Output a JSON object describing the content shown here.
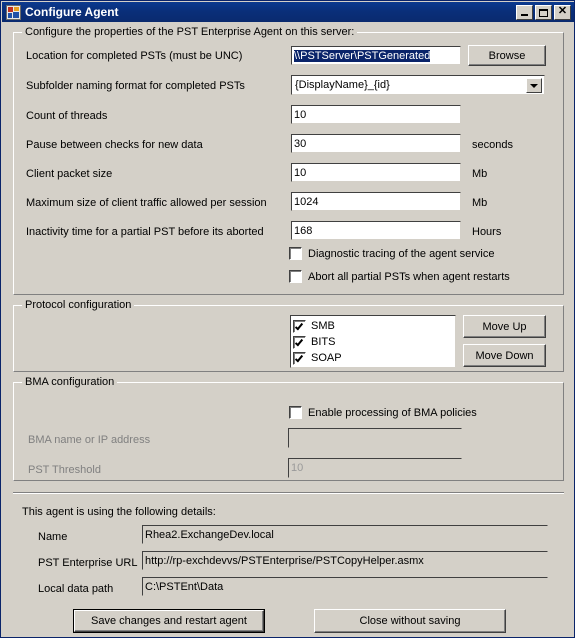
{
  "window": {
    "title": "Configure Agent",
    "icon": "application-form-icon",
    "controls": {
      "minimize": "minimize-button",
      "maximize": "maximize-button",
      "close": "close-button"
    }
  },
  "main_group": {
    "legend": "Configure the properties of the PST Enterprise Agent on this server:",
    "fields": [
      {
        "label": "Location for completed PSTs (must be UNC)",
        "value": "\\\\PSTServer\\PSTGenerated",
        "selected": true,
        "unit": ""
      },
      {
        "label": "Subfolder naming format for completed PSTs",
        "value": "{DisplayName}_{id}",
        "unit": "",
        "type": "combobox"
      },
      {
        "label": "Count of threads",
        "value": "10",
        "unit": ""
      },
      {
        "label": "Pause between checks for new data",
        "value": "30",
        "unit": "seconds"
      },
      {
        "label": "Client packet size",
        "value": "10",
        "unit": "Mb"
      },
      {
        "label": "Maximum size of client traffic allowed per session",
        "value": "1024",
        "unit": "Mb"
      },
      {
        "label": "Inactivity time for a partial PST before its aborted",
        "value": "168",
        "unit": "Hours"
      }
    ],
    "browse_button": "Browse",
    "checkboxes": [
      {
        "label": "Diagnostic tracing of the agent service",
        "checked": false
      },
      {
        "label": "Abort all partial PSTs when agent restarts",
        "checked": false
      }
    ]
  },
  "protocol_group": {
    "legend": "Protocol configuration",
    "items": [
      {
        "label": "SMB",
        "checked": true
      },
      {
        "label": "BITS",
        "checked": true
      },
      {
        "label": "SOAP",
        "checked": true
      }
    ],
    "move_up": "Move Up",
    "move_down": "Move Down"
  },
  "bma_group": {
    "legend": "BMA configuration",
    "enable_checkbox": {
      "label": "Enable processing of BMA policies",
      "checked": false
    },
    "fields": [
      {
        "label": "BMA name or IP address",
        "value": "",
        "disabled": true
      },
      {
        "label": "PST Threshold",
        "value": "10",
        "disabled": true
      }
    ]
  },
  "details": {
    "heading": "This agent is using the following details:",
    "rows": [
      {
        "label": "Name",
        "value": "Rhea2.ExchangeDev.local"
      },
      {
        "label": "PST Enterprise URL",
        "value": "http://rp-exchdevvs/PSTEnterprise/PSTCopyHelper.asmx"
      },
      {
        "label": "Local data path",
        "value": "C:\\PSTEnt\\Data"
      }
    ]
  },
  "footer": {
    "save_button": "Save changes and restart agent",
    "close_button": "Close without saving"
  },
  "colors": {
    "face": "#d4d0c8",
    "title_bar": "#0a2f7a",
    "selection": "#0a246a",
    "disabled_text": "#9a9a9a"
  }
}
